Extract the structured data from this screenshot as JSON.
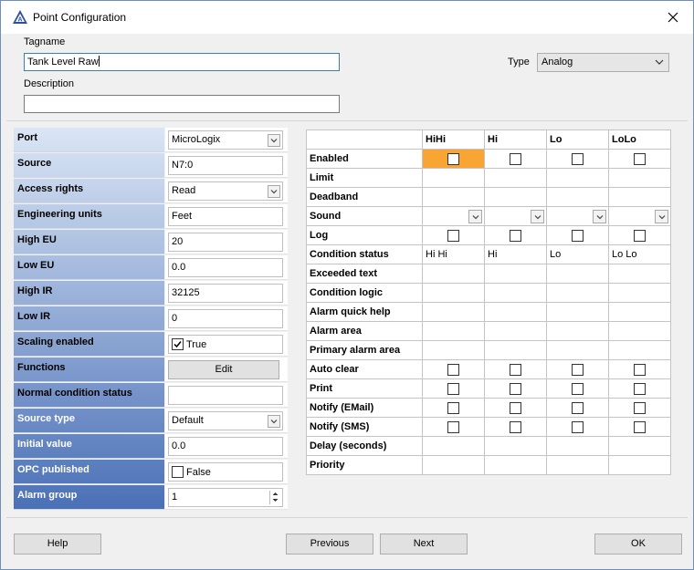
{
  "window": {
    "title": "Point Configuration"
  },
  "header": {
    "tagname_label": "Tagname",
    "tagname_value": "Tank Level Raw",
    "description_label": "Description",
    "description_value": "",
    "type_label": "Type",
    "type_value": "Analog"
  },
  "properties": [
    {
      "name": "Port",
      "value": "MicroLogix",
      "kind": "combo"
    },
    {
      "name": "Source",
      "value": "N7:0",
      "kind": "text"
    },
    {
      "name": "Access rights",
      "value": "Read",
      "kind": "combo"
    },
    {
      "name": "Engineering units",
      "value": "Feet",
      "kind": "text"
    },
    {
      "name": "High EU",
      "value": "20",
      "kind": "text"
    },
    {
      "name": "Low EU",
      "value": "0.0",
      "kind": "text"
    },
    {
      "name": "High IR",
      "value": "32125",
      "kind": "text"
    },
    {
      "name": "Low IR",
      "value": "0",
      "kind": "text"
    },
    {
      "name": "Scaling enabled",
      "value": "True",
      "kind": "check",
      "checked": true
    },
    {
      "name": "Functions",
      "value": "Edit",
      "kind": "button"
    },
    {
      "name": "Normal condition status",
      "value": "",
      "kind": "text"
    },
    {
      "name": "Source type",
      "value": "Default",
      "kind": "combo"
    },
    {
      "name": "Initial value",
      "value": "0.0",
      "kind": "text"
    },
    {
      "name": "OPC published",
      "value": "False",
      "kind": "check",
      "checked": false
    },
    {
      "name": "Alarm group",
      "value": "1",
      "kind": "spin"
    }
  ],
  "alarms": {
    "columns": [
      "HiHi",
      "Hi",
      "Lo",
      "LoLo"
    ],
    "rows": [
      {
        "name": "Enabled",
        "kind": "check"
      },
      {
        "name": "Limit",
        "kind": "empty"
      },
      {
        "name": "Deadband",
        "kind": "empty"
      },
      {
        "name": "Sound",
        "kind": "combo"
      },
      {
        "name": "Log",
        "kind": "check"
      },
      {
        "name": "Condition status",
        "kind": "text",
        "values": [
          "Hi Hi",
          "Hi",
          "Lo",
          "Lo Lo"
        ]
      },
      {
        "name": "Exceeded text",
        "kind": "empty"
      },
      {
        "name": "Condition logic",
        "kind": "empty"
      },
      {
        "name": "Alarm quick help",
        "kind": "empty"
      },
      {
        "name": "Alarm area",
        "kind": "empty"
      },
      {
        "name": "Primary alarm area",
        "kind": "empty"
      },
      {
        "name": "Auto clear",
        "kind": "check"
      },
      {
        "name": "Print",
        "kind": "check"
      },
      {
        "name": "Notify (EMail)",
        "kind": "check"
      },
      {
        "name": "Notify (SMS)",
        "kind": "check"
      },
      {
        "name": "Delay (seconds)",
        "kind": "empty"
      },
      {
        "name": "Priority",
        "kind": "empty"
      }
    ]
  },
  "footer": {
    "help": "Help",
    "previous": "Previous",
    "next": "Next",
    "ok": "OK"
  },
  "colors": {
    "grid_gradient_top": "#dbe6f5",
    "grid_gradient_bottom": "#4a70b6",
    "selected_cell": "#f8a533"
  },
  "icons": [
    "app-logo-icon",
    "close-icon",
    "chevron-down-icon",
    "checkbox-icon",
    "spin-up-icon",
    "spin-down-icon"
  ]
}
